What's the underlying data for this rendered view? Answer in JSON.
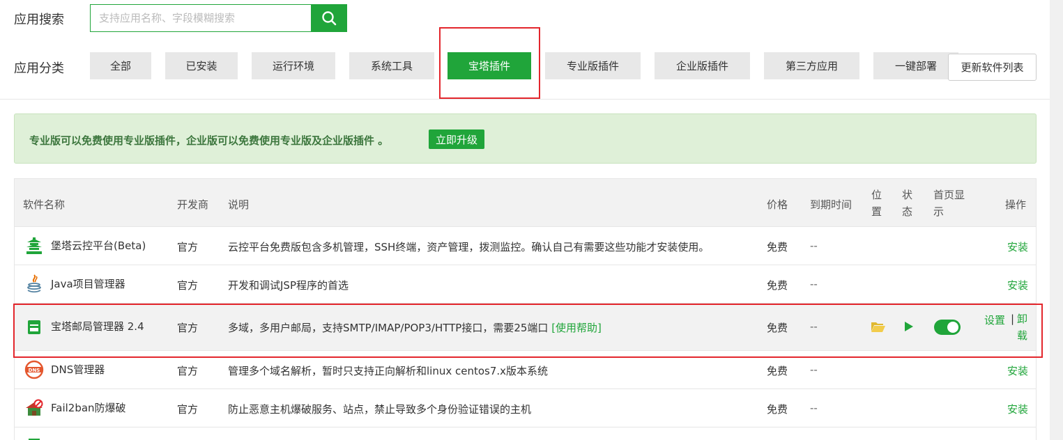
{
  "search": {
    "label": "应用搜索",
    "placeholder": "支持应用名称、字段模糊搜索"
  },
  "category": {
    "label": "应用分类",
    "items": [
      "全部",
      "已安装",
      "运行环境",
      "系统工具",
      "宝塔插件",
      "专业版插件",
      "企业版插件",
      "第三方应用",
      "一键部署"
    ],
    "active": "宝塔插件",
    "refresh_label": "更新软件列表"
  },
  "notice": {
    "text": "专业版可以免费使用专业版插件，企业版可以免费使用专业版及企业版插件 。",
    "upgrade_label": "立即升级"
  },
  "table": {
    "headers": {
      "name": "软件名称",
      "developer": "开发商",
      "desc": "说明",
      "price": "价格",
      "expire": "到期时间",
      "position_1": "位",
      "position_2": "置",
      "status_1": "状",
      "status_2": "态",
      "home_1": "首页显",
      "home_2": "示",
      "ops": "操作"
    },
    "rows": [
      {
        "name": "堡塔云控平台(Beta)",
        "developer": "官方",
        "desc": "云控平台免费版包含多机管理，SSH终端，资产管理，拨测监控。确认自己有需要这些功能才安装使用。",
        "price": "免费",
        "expire": "--",
        "op": "安装",
        "icon": "pagoda-icon"
      },
      {
        "name": "Java项目管理器",
        "developer": "官方",
        "desc": "开发和调试JSP程序的首选",
        "price": "免费",
        "expire": "--",
        "op": "安装",
        "icon": "java-icon"
      },
      {
        "name": "宝塔邮局管理器 2.4",
        "developer": "官方",
        "desc": "多域，多用户邮局，支持SMTP/IMAP/POP3/HTTP接口，需要25端口",
        "help": "[使用帮助]",
        "price": "免费",
        "expire": "--",
        "op_settings": "设置",
        "op_sep": "|",
        "op_uninstall_1": "卸",
        "op_uninstall_2": "载",
        "icon": "mail-server-icon",
        "home_display": true
      },
      {
        "name": "DNS管理器",
        "developer": "官方",
        "desc": "管理多个域名解析，暂时只支持正向解析和linux centos7.x版本系统",
        "price": "免费",
        "expire": "--",
        "op": "安装",
        "icon": "dns-icon"
      },
      {
        "name": "Fail2ban防爆破",
        "developer": "官方",
        "desc": "防止恶意主机爆破服务、站点，禁止导致多个身份验证错误的主机",
        "price": "免费",
        "expire": "--",
        "op": "安装",
        "icon": "fail2ban-icon"
      }
    ]
  },
  "colors": {
    "accent": "#20a53a",
    "highlight_border": "#e3262c",
    "notice_bg": "#dff0d8",
    "notice_text": "#3c763d"
  }
}
